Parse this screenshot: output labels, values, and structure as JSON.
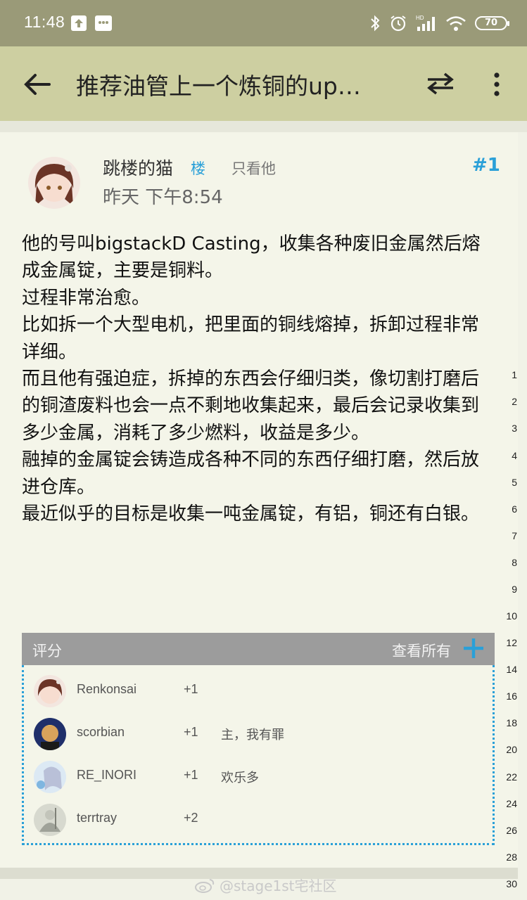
{
  "status_bar": {
    "time": "11:48",
    "battery": "70",
    "icons": [
      "upload-icon",
      "message-icon",
      "bluetooth-icon",
      "alarm-icon",
      "hd-signal-icon",
      "wifi-icon",
      "battery-icon"
    ]
  },
  "app_bar": {
    "title": "推荐油管上一个炼铜的up…",
    "icons": [
      "back-arrow-icon",
      "swap-icon",
      "more-vertical-icon"
    ]
  },
  "post": {
    "author": "跳楼的猫",
    "floor_tag": "楼",
    "only_him": "只看他",
    "post_number": "#1",
    "time": "昨天 下午8:54",
    "content": [
      "他的号叫bigstackD Casting，收集各种废旧金属然后熔成金属锭，主要是铜料。",
      "过程非常治愈。",
      "比如拆一个大型电机，把里面的铜线熔掉，拆卸过程非常详细。",
      "而且他有强迫症，拆掉的东西会仔细归类，像切割打磨后的铜渣废料也会一点不剩地收集起来，最后会记录收集到多少金属，消耗了多少燃料，收益是多少。",
      "融掉的金属锭会铸造成各种不同的东西仔细打磨，然后放进仓库。",
      "最近似乎的目标是收集一吨金属锭，有铝，铜还有白银。"
    ]
  },
  "ratings": {
    "title": "评分",
    "view_all": "查看所有",
    "rows": [
      {
        "user": "Renkonsai",
        "score": "+1",
        "reason": ""
      },
      {
        "user": "scorbian",
        "score": "+1",
        "reason": "主，我有罪"
      },
      {
        "user": "RE_INORI",
        "score": "+1",
        "reason": "欢乐多"
      },
      {
        "user": "terrtray",
        "score": "+2",
        "reason": ""
      }
    ]
  },
  "line_numbers": [
    "1",
    "2",
    "3",
    "4",
    "5",
    "6",
    "7",
    "8",
    "9",
    "10",
    "12",
    "14",
    "16",
    "18",
    "20",
    "22",
    "24",
    "26",
    "28",
    "30"
  ],
  "watermark": "@stage1st宅社区",
  "colors": {
    "status_bar": "#9a9a78",
    "app_bar": "#cdcfa1",
    "background": "#f1f2e7",
    "accent": "#2aa0d8",
    "rating_header": "#9c9c9c"
  }
}
